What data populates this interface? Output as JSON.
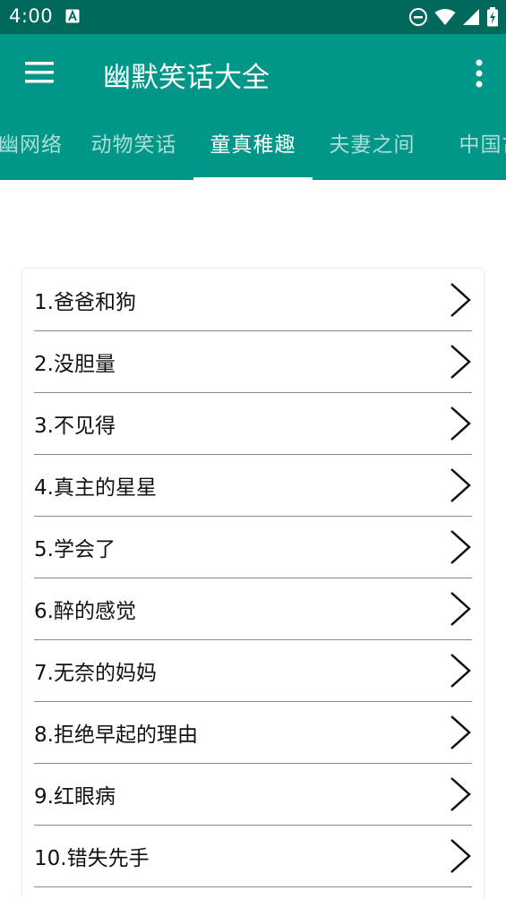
{
  "status_bar": {
    "time": "4:00",
    "icons": [
      "a-icon",
      "do-not-disturb-icon",
      "wifi-icon",
      "signal-icon",
      "battery-icon"
    ]
  },
  "app_bar": {
    "title": "幽默笑话大全",
    "menu_icon": "menu-icon",
    "more_icon": "more-vert-icon",
    "color": "#009688",
    "status_color": "#00695c"
  },
  "tabs": [
    {
      "label": "幽网络"
    },
    {
      "label": "动物笑话"
    },
    {
      "label": "童真稚趣",
      "active": true
    },
    {
      "label": "夫妻之间"
    },
    {
      "label": "中国古"
    }
  ],
  "list": {
    "items": [
      {
        "title": "1.爸爸和狗"
      },
      {
        "title": "2.没胆量"
      },
      {
        "title": "3.不见得"
      },
      {
        "title": "4.真主的星星"
      },
      {
        "title": "5.学会了"
      },
      {
        "title": "6.醉的感觉"
      },
      {
        "title": "7.无奈的妈妈"
      },
      {
        "title": "8.拒绝早起的理由"
      },
      {
        "title": "9.红眼病"
      },
      {
        "title": "10.错失先手"
      }
    ],
    "item_icon": "chevron-right-icon"
  }
}
